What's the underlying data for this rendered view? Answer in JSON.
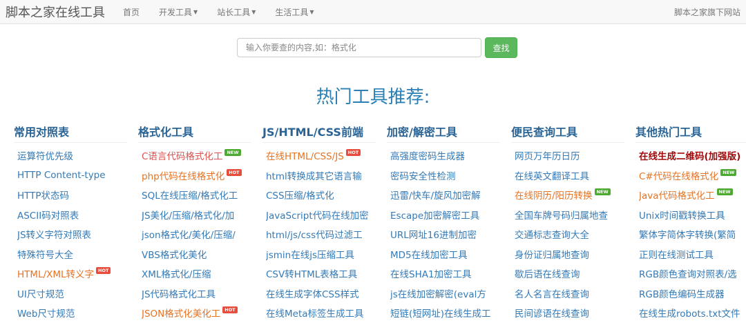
{
  "navbar": {
    "brand": "脚本之家在线工具",
    "items": [
      {
        "label": "首页",
        "dropdown": false
      },
      {
        "label": "开发工具",
        "dropdown": true
      },
      {
        "label": "站长工具",
        "dropdown": true
      },
      {
        "label": "生活工具",
        "dropdown": true
      }
    ],
    "right_link": "脚本之家旗下网站"
  },
  "search": {
    "placeholder": "输入你要查的内容,如：格式化",
    "button": "查找"
  },
  "hero_title": "热门工具推荐:",
  "colors": {
    "accent_blue": "#337ab7",
    "title_blue": "#2a7fb5",
    "hot_orange": "#e67324",
    "hot_red": "#d9534f",
    "button_green": "#5cb85c",
    "badge_hot": "#e74c3c",
    "badge_new": "#4caa31"
  },
  "columns": [
    {
      "title": "常用对照表",
      "links": [
        {
          "text": "运算符优先级",
          "color": "blue",
          "badge": ""
        },
        {
          "text": "HTTP Content-type",
          "color": "blue",
          "badge": ""
        },
        {
          "text": "HTTP状态码",
          "color": "blue",
          "badge": ""
        },
        {
          "text": "ASCII码对照表",
          "color": "blue",
          "badge": ""
        },
        {
          "text": "JS转义字符对照表",
          "color": "blue",
          "badge": ""
        },
        {
          "text": "特殊符号大全",
          "color": "blue",
          "badge": ""
        },
        {
          "text": "HTML/XML转义字",
          "color": "orange",
          "badge": "HOT"
        },
        {
          "text": "UI尺寸规范",
          "color": "blue",
          "badge": ""
        },
        {
          "text": "Web尺寸规范",
          "color": "blue",
          "badge": ""
        }
      ]
    },
    {
      "title": "格式化工具",
      "links": [
        {
          "text": "C语言代码格式化工",
          "color": "red",
          "badge": "NEW"
        },
        {
          "text": "php代码在线格式化",
          "color": "orange",
          "badge": "HOT"
        },
        {
          "text": "SQL在线压缩/格式化工",
          "color": "blue",
          "badge": ""
        },
        {
          "text": "JS美化/压缩/格式化/加",
          "color": "blue",
          "badge": ""
        },
        {
          "text": "json格式化/美化/压缩/",
          "color": "blue",
          "badge": ""
        },
        {
          "text": "VBS格式化美化",
          "color": "blue",
          "badge": ""
        },
        {
          "text": "XML格式化/压缩",
          "color": "blue",
          "badge": ""
        },
        {
          "text": "JS代码格式化工具",
          "color": "blue",
          "badge": ""
        },
        {
          "text": "JSON格式化美化工",
          "color": "orange",
          "badge": "HOT"
        }
      ]
    },
    {
      "title": "JS/HTML/CSS前端",
      "links": [
        {
          "text": "在线HTML/CSS/JS",
          "color": "orange",
          "badge": "HOT"
        },
        {
          "text": "html转换成其它语言输",
          "color": "blue",
          "badge": ""
        },
        {
          "text": "CSS压缩/格式化",
          "color": "blue",
          "badge": ""
        },
        {
          "text": "JavaScript代码在线加密",
          "color": "blue",
          "badge": ""
        },
        {
          "text": "html/js/css代码过滤工",
          "color": "blue",
          "badge": ""
        },
        {
          "text": "jsmin在线js压缩工具",
          "color": "blue",
          "badge": ""
        },
        {
          "text": "CSV转HTML表格工具",
          "color": "blue",
          "badge": ""
        },
        {
          "text": "在线生成字体CSS样式",
          "color": "blue",
          "badge": ""
        },
        {
          "text": "在线Meta标签生成工具",
          "color": "blue",
          "badge": ""
        }
      ]
    },
    {
      "title": "加密/解密工具",
      "links": [
        {
          "text": "高强度密码生成器",
          "color": "blue",
          "badge": ""
        },
        {
          "text": "密码安全性检测",
          "color": "blue",
          "badge": ""
        },
        {
          "text": "迅雷/快车/旋风加密解",
          "color": "blue",
          "badge": ""
        },
        {
          "text": "Escape加密解密工具",
          "color": "blue",
          "badge": ""
        },
        {
          "text": "URL网址16进制加密",
          "color": "blue",
          "badge": ""
        },
        {
          "text": "MD5在线加密工具",
          "color": "blue",
          "badge": ""
        },
        {
          "text": "在线SHA1加密工具",
          "color": "blue",
          "badge": ""
        },
        {
          "text": "js在线加密解密(eval方",
          "color": "blue",
          "badge": ""
        },
        {
          "text": "短链(短网址)在线生成工",
          "color": "blue",
          "badge": ""
        }
      ]
    },
    {
      "title": "便民查询工具",
      "links": [
        {
          "text": "网页万年历日历",
          "color": "blue",
          "badge": ""
        },
        {
          "text": "在线英文翻译工具",
          "color": "blue",
          "badge": ""
        },
        {
          "text": "在线阴历/阳历转换",
          "color": "orange",
          "badge": "NEW"
        },
        {
          "text": "全国车牌号码归属地查",
          "color": "blue",
          "badge": ""
        },
        {
          "text": "交通标志查询大全",
          "color": "blue",
          "badge": ""
        },
        {
          "text": "身份证归属地查询",
          "color": "blue",
          "badge": ""
        },
        {
          "text": "歇后语在线查询",
          "color": "blue",
          "badge": ""
        },
        {
          "text": "名人名言在线查询",
          "color": "blue",
          "badge": ""
        },
        {
          "text": "民间谚语在线查询",
          "color": "blue",
          "badge": ""
        }
      ]
    },
    {
      "title": "其他热门工具",
      "links": [
        {
          "text": "在线生成二维码(加强版)",
          "color": "darkred",
          "badge": ""
        },
        {
          "text": "C#代码在线格式化",
          "color": "orange",
          "badge": "NEW"
        },
        {
          "text": "Java代码格式化工",
          "color": "orange",
          "badge": "NEW"
        },
        {
          "text": "Unix时间戳转换工具",
          "color": "blue",
          "badge": ""
        },
        {
          "text": "繁体字简体字转换(繁简",
          "color": "blue",
          "badge": ""
        },
        {
          "text": "正则在线测试工具",
          "color": "blue",
          "badge": ""
        },
        {
          "text": "RGB颜色查询对照表/选",
          "color": "blue",
          "badge": ""
        },
        {
          "text": "RGB颜色编码生成器",
          "color": "blue",
          "badge": ""
        },
        {
          "text": "在线生成robots.txt文件",
          "color": "blue",
          "badge": ""
        }
      ]
    }
  ]
}
